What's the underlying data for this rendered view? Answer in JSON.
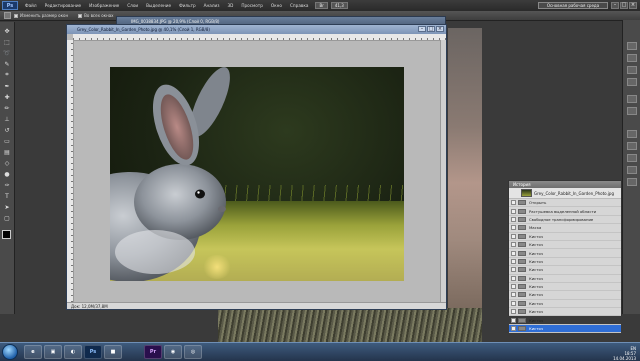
{
  "app": {
    "logo": "Ps",
    "workspace_label": "Основная рабочая среда",
    "window_controls": [
      "–",
      "□",
      "×"
    ]
  },
  "menubar": {
    "items": [
      "Файл",
      "Редактирование",
      "Изображение",
      "Слои",
      "Выделение",
      "Фильтр",
      "Анализ",
      "3D",
      "Просмотр",
      "Окно",
      "Справка"
    ],
    "view_extras": "Br",
    "zoom": "41,3"
  },
  "options_bar": {
    "resize_windows": "Изменить размер окон",
    "all_windows": "Во всех окнах"
  },
  "documents": {
    "back_title": "IMG_0038834.JPG @ 20,9% (Слой 0, RGB/8)",
    "front_title": "Grey_Color_Rabbit_In_Garden_Photo.jpg @ 40,1% (Слой 1, RGB/8)",
    "status": "Док: 12,0M/37,8M"
  },
  "history_panel": {
    "title": "История",
    "snapshot": "Grey_Color_Rabbit_In_Garden_Photo.jpg",
    "states": [
      {
        "label": "Открыть",
        "selected": false
      },
      {
        "label": "Растушевка выделенной области",
        "selected": false
      },
      {
        "label": "Свободное трансформирование",
        "selected": false
      },
      {
        "label": "Маска",
        "selected": false
      },
      {
        "label": "Кисточ",
        "selected": false
      },
      {
        "label": "Кисточ",
        "selected": false
      },
      {
        "label": "Кисточ",
        "selected": false
      },
      {
        "label": "Кисточ",
        "selected": false
      },
      {
        "label": "Кисточ",
        "selected": false
      },
      {
        "label": "Кисточ",
        "selected": false
      },
      {
        "label": "Кисточ",
        "selected": false
      },
      {
        "label": "Кисточ",
        "selected": false
      },
      {
        "label": "Кисточ",
        "selected": false
      },
      {
        "label": "Кисточ",
        "selected": false
      },
      {
        "label": "Кисточ",
        "selected": false
      },
      {
        "label": "Кисточ",
        "selected": true
      }
    ]
  },
  "taskbar": {
    "apps": [
      "e",
      "▣",
      "◐",
      "Ps",
      "■",
      "Pr",
      "◉",
      "◎"
    ],
    "lang": "EN",
    "clock": "18:57",
    "date": "14.04.2013"
  },
  "colors": {
    "history_selection": "#2f6ed6",
    "title_bar": "#7d94b6"
  }
}
